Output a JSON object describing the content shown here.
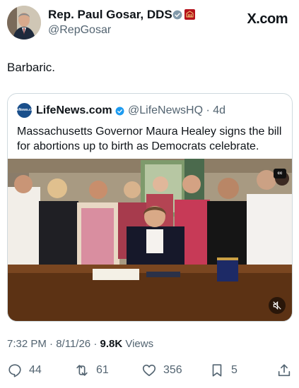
{
  "author": {
    "name": "Rep. Paul Gosar, DDS",
    "handle": "@RepGosar"
  },
  "brand": "X.com",
  "tweet": {
    "text": "Barbaric."
  },
  "quote": {
    "avatar_text": "LifeNews.com",
    "name": "LifeNews.com",
    "handle_time": "@LifeNewsHQ · 4d",
    "text": "Massachusetts Governor Maura Healey signs the bill for abortions up to birth as Democrats celebrate.",
    "cc_label": "cc"
  },
  "meta": {
    "time": "7:32 PM",
    "date": "8/11/26",
    "views_count": "9.8K",
    "views_label": "Views"
  },
  "actions": {
    "replies": "44",
    "reposts": "61",
    "likes": "356",
    "bookmarks": "5"
  },
  "colors": {
    "verified": "#1d9bf0",
    "text": "#0f1419",
    "secondary": "#536471",
    "affiliation": "#b5121b"
  }
}
